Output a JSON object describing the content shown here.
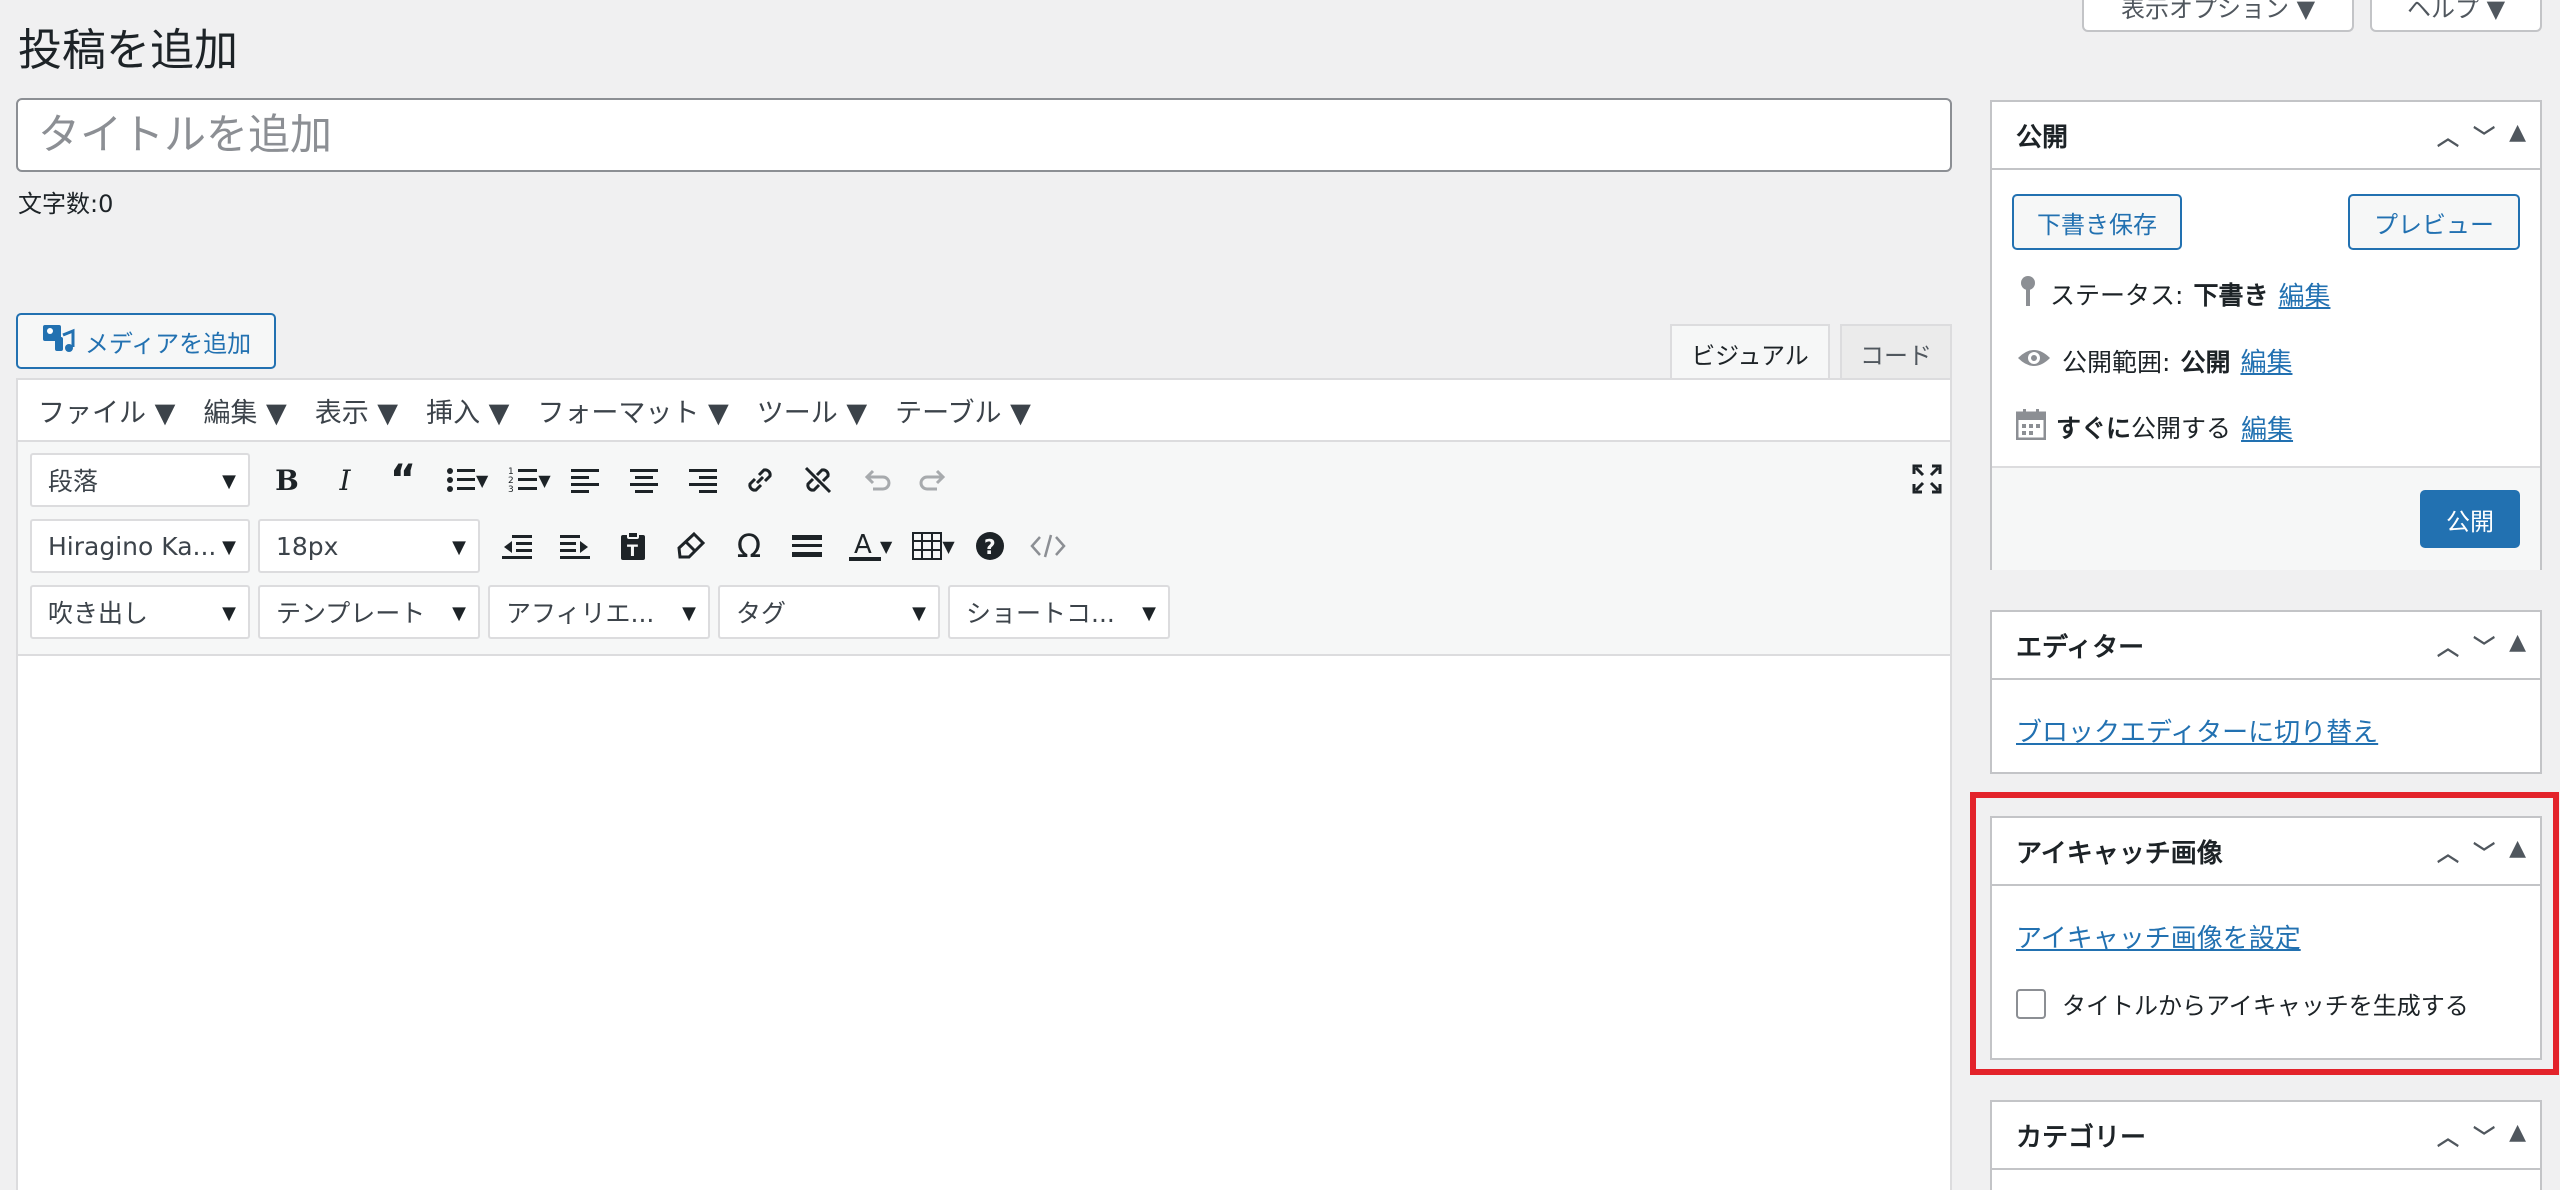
{
  "header": {
    "title": "投稿を追加",
    "screen_options": "表示オプション ▼",
    "help": "ヘルプ ▼"
  },
  "title_input": {
    "placeholder": "タイトルを追加"
  },
  "word_count": "文字数:0",
  "media_button": "メディアを追加",
  "editor_tabs": {
    "visual": "ビジュアル",
    "code": "コード"
  },
  "menu": [
    "ファイル ▼",
    "編集 ▼",
    "表示 ▼",
    "挿入 ▼",
    "フォーマット ▼",
    "ツール ▼",
    "テーブル ▼"
  ],
  "toolbar": {
    "paragraph": "段落",
    "font": "Hiragino Ka...",
    "font_size": "18px",
    "balloon": "吹き出し",
    "template": "テンプレート",
    "affiliate": "アフィリエ...",
    "tag": "タグ",
    "shortcode": "ショートコ..."
  },
  "publish_box": {
    "title": "公開",
    "save_draft": "下書き保存",
    "preview": "プレビュー",
    "status_label": "ステータス:",
    "status_value": "下書き",
    "status_edit": "編集",
    "visibility_label": "公開範囲:",
    "visibility_value": "公開",
    "visibility_edit": "編集",
    "schedule_bold": "すぐに",
    "schedule_rest": "公開する",
    "schedule_edit": "編集",
    "publish": "公開"
  },
  "editor_box": {
    "title": "エディター",
    "switch_link": "ブロックエディターに切り替え"
  },
  "featured_box": {
    "title": "アイキャッチ画像",
    "set_link": "アイキャッチ画像を設定",
    "generate_label": "タイトルからアイキャッチを生成する"
  },
  "category_box": {
    "title": "カテゴリー"
  },
  "colors": {
    "accent": "#2271b1",
    "highlight": "#e3232b"
  }
}
